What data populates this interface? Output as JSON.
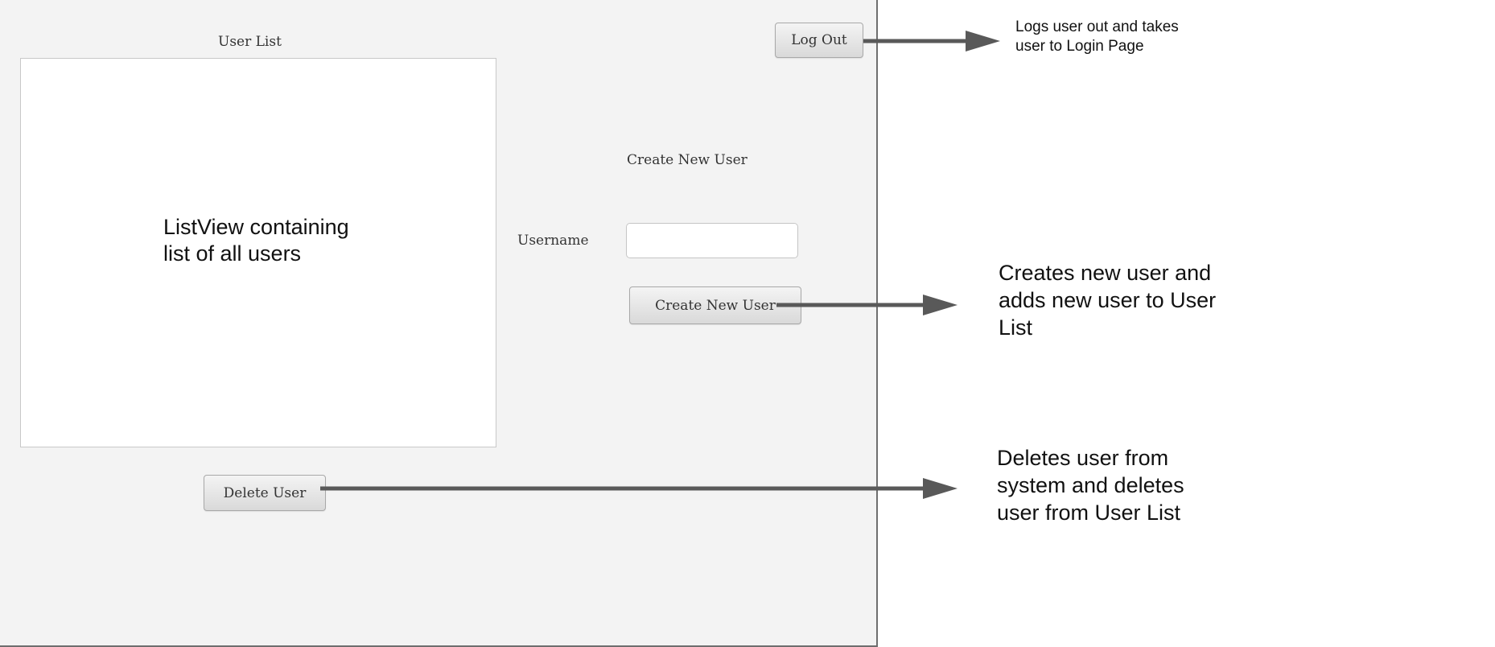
{
  "window": {
    "user_list_title": "User List",
    "list_placeholder": "ListView containing\nlist of all users",
    "logout_label": "Log Out",
    "create_section_title": "Create New User",
    "username_label": "Username",
    "username_value": "",
    "create_button_label": "Create New User",
    "delete_button_label": "Delete User"
  },
  "annotations": {
    "logout": "Logs user out and takes\nuser to Login Page",
    "create": "Creates new user and\nadds new user to User\nList",
    "delete": "Deletes user from\nsystem and deletes\nuser from User List"
  },
  "colors": {
    "window_bg": "#f3f3f3",
    "arrow": "#595959"
  }
}
